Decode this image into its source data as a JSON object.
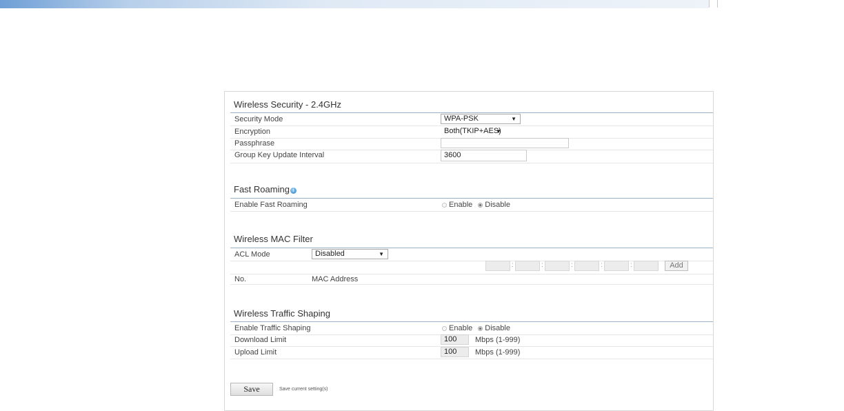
{
  "wireless_security": {
    "title": "Wireless Security - 2.4GHz",
    "security_mode": {
      "label": "Security Mode",
      "value": "WPA-PSK"
    },
    "encryption": {
      "label": "Encryption",
      "value": "Both(TKIP+AES)"
    },
    "passphrase": {
      "label": "Passphrase",
      "value": ""
    },
    "group_key": {
      "label": "Group Key Update Interval",
      "value": "3600"
    }
  },
  "fast_roaming": {
    "title": "Fast Roaming",
    "enable_label": "Enable Fast Roaming",
    "opt_enable": "Enable",
    "opt_disable": "Disable",
    "selected": "Disable"
  },
  "mac_filter": {
    "title": "Wireless MAC Filter",
    "acl_label": "ACL Mode",
    "acl_value": "Disabled",
    "add_label": "Add",
    "col_no": "No.",
    "col_mac": "MAC Address"
  },
  "traffic_shaping": {
    "title": "Wireless Traffic Shaping",
    "enable_label": "Enable Traffic Shaping",
    "opt_enable": "Enable",
    "opt_disable": "Disable",
    "selected": "Disable",
    "download": {
      "label": "Download Limit",
      "value": "100",
      "unit": "Mbps (1-999)"
    },
    "upload": {
      "label": "Upload Limit",
      "value": "100",
      "unit": "Mbps (1-999)"
    }
  },
  "footer": {
    "save_label": "Save",
    "save_hint": "Save current setting(s)"
  },
  "colors": {
    "header_gradient_start": "#6f9fd6",
    "section_rule": "#9ab0c8"
  }
}
